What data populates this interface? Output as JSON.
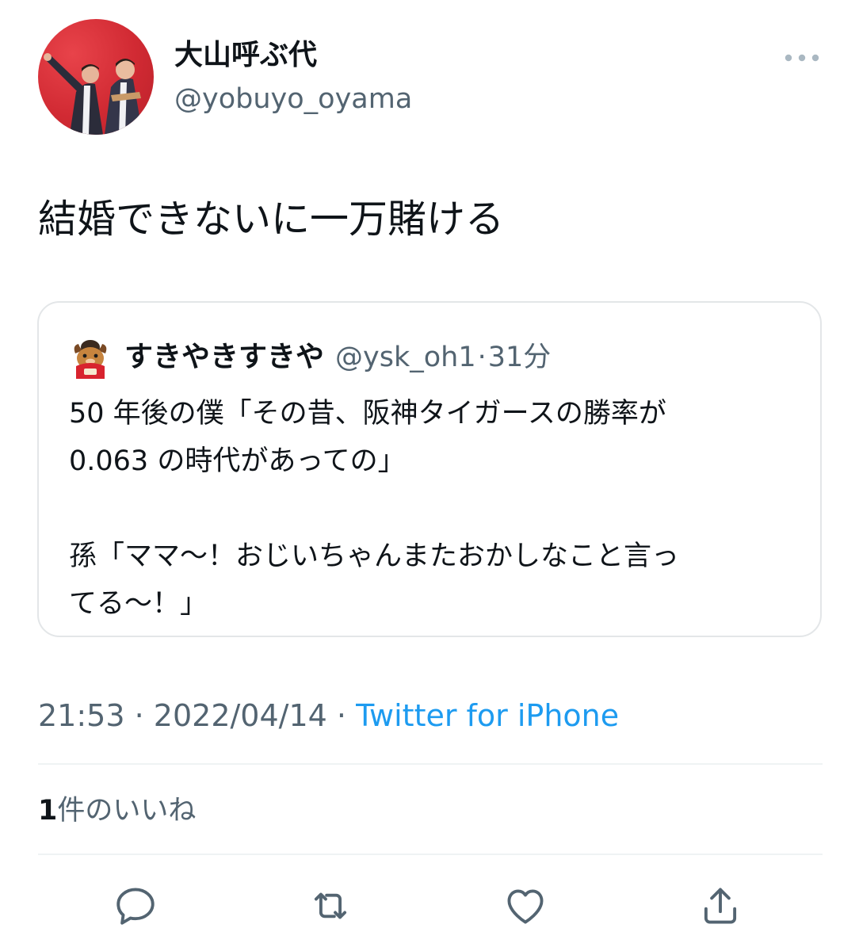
{
  "author": {
    "display_name": "大山呼ぶ代",
    "handle": "@yobuyo_oyama"
  },
  "tweet": {
    "text": "結婚できないに一万賭ける"
  },
  "quoted_tweet": {
    "display_name": "すきやきすきや",
    "handle": "@ysk_oh1",
    "separator": "·",
    "time_ago": "31分",
    "lines": [
      "50 年後の僕「その昔、阪神タイガースの勝率が",
      "0.063 の時代があっての」",
      "",
      "孫「ママ〜！おじいちゃんまたおかしなこと言っ",
      "てる〜！」"
    ]
  },
  "meta": {
    "time": "21:53",
    "separator": "·",
    "date": "2022/04/14",
    "source": "Twitter for iPhone"
  },
  "likes": {
    "count": "1",
    "label": "件のいいね"
  },
  "icons": {
    "more": "more-horizontal-icon",
    "reply": "reply-icon",
    "retweet": "retweet-icon",
    "like": "heart-icon",
    "share": "share-icon"
  },
  "colors": {
    "text_primary": "#0f1419",
    "text_secondary": "#536471",
    "link": "#1d9bf0",
    "border": "#e3e6e8",
    "avatar_bg": "#d12a33"
  }
}
